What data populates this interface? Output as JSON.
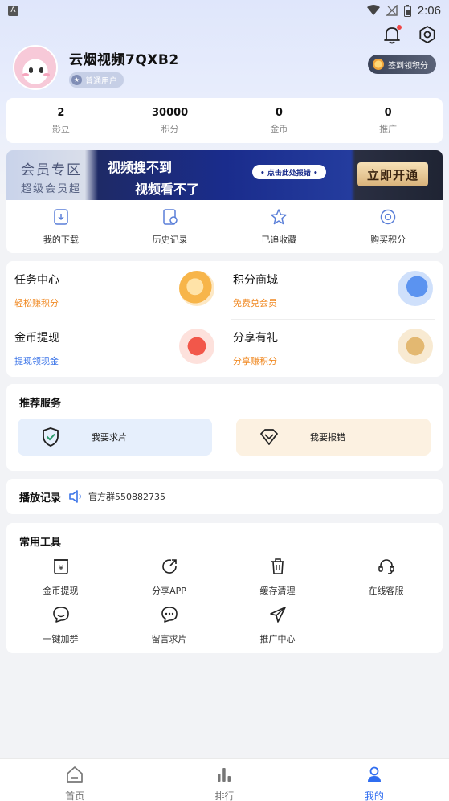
{
  "status_bar": {
    "time": "2:06",
    "app_indicator": "A"
  },
  "profile": {
    "username": "云烟视频7QXB2",
    "badge": "普通用户",
    "signin_label": "签到领积分"
  },
  "stats": [
    {
      "value": "2",
      "label": "影豆"
    },
    {
      "value": "30000",
      "label": "积分"
    },
    {
      "value": "0",
      "label": "金币"
    },
    {
      "value": "0",
      "label": "推广"
    }
  ],
  "vip_banner": {
    "left_line1": "会员专区",
    "left_line2": "超级会员超",
    "mid_line1": "视频搜不到",
    "mid_line2": "视频看不了",
    "click_label": "• 点击此处报错 •",
    "open_label": "立即开通"
  },
  "quick_actions": [
    {
      "label": "我的下载",
      "icon": "download-icon"
    },
    {
      "label": "历史记录",
      "icon": "history-icon"
    },
    {
      "label": "已追收藏",
      "icon": "star-icon"
    },
    {
      "label": "购买积分",
      "icon": "points-icon"
    }
  ],
  "tasks": [
    {
      "title": "任务中心",
      "subtitle": "轻松赚积分",
      "color": "#f08a24"
    },
    {
      "title": "积分商城",
      "subtitle": "免费兑会员",
      "color": "#f08a24"
    },
    {
      "title": "金币提现",
      "subtitle": "提现领现金",
      "color": "#3b74e8"
    },
    {
      "title": "分享有礼",
      "subtitle": "分享赚积分",
      "color": "#f08a24"
    }
  ],
  "recommend": {
    "title": "推荐服务",
    "request_label": "我要求片",
    "report_label": "我要报错"
  },
  "play_record": {
    "title": "播放记录",
    "group_text": "官方群550882735"
  },
  "tools": {
    "title": "常用工具",
    "items": [
      {
        "label": "金币提现",
        "icon": "yen-box-icon"
      },
      {
        "label": "分享APP",
        "icon": "share-icon"
      },
      {
        "label": "缓存清理",
        "icon": "trash-icon"
      },
      {
        "label": "在线客服",
        "icon": "headset-icon"
      },
      {
        "label": "一键加群",
        "icon": "chat-bubble-icon"
      },
      {
        "label": "留言求片",
        "icon": "message-icon"
      },
      {
        "label": "推广中心",
        "icon": "paper-plane-icon"
      }
    ]
  },
  "tabbar": [
    {
      "label": "首页",
      "icon": "home-icon",
      "active": false
    },
    {
      "label": "排行",
      "icon": "ranking-icon",
      "active": false
    },
    {
      "label": "我的",
      "icon": "profile-icon",
      "active": true
    }
  ],
  "colors": {
    "accent": "#2f6df0",
    "orange": "#f08a24",
    "blue_sub": "#3b74e8"
  }
}
